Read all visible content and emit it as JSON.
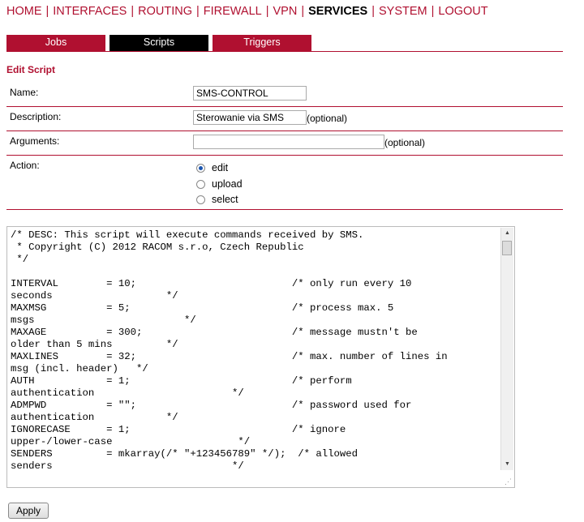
{
  "nav": {
    "items": [
      {
        "label": "HOME",
        "active": false
      },
      {
        "label": "INTERFACES",
        "active": false
      },
      {
        "label": "ROUTING",
        "active": false
      },
      {
        "label": "FIREWALL",
        "active": false
      },
      {
        "label": "VPN",
        "active": false
      },
      {
        "label": "SERVICES",
        "active": true
      },
      {
        "label": "SYSTEM",
        "active": false
      },
      {
        "label": "LOGOUT",
        "active": false
      }
    ],
    "separator": "|"
  },
  "tabs": [
    {
      "label": "Jobs",
      "active": false
    },
    {
      "label": "Scripts",
      "active": true
    },
    {
      "label": "Triggers",
      "active": false
    }
  ],
  "section_title": "Edit Script",
  "form": {
    "name_label": "Name:",
    "name_value": "SMS-CONTROL",
    "description_label": "Description:",
    "description_value": "Sterowanie via SMS",
    "description_hint": "(optional)",
    "arguments_label": "Arguments:",
    "arguments_value": "",
    "arguments_hint": "(optional)",
    "action_label": "Action:",
    "action_options": [
      {
        "label": "edit",
        "checked": true
      },
      {
        "label": "upload",
        "checked": false
      },
      {
        "label": "select",
        "checked": false
      }
    ]
  },
  "script_text": "/* DESC: This script will execute commands received by SMS.\n * Copyright (C) 2012 RACOM s.r.o, Czech Republic\n */\n\nINTERVAL        = 10;                          /* only run every 10\nseconds                   */\nMAXMSG          = 5;                           /* process max. 5\nmsgs                         */\nMAXAGE          = 300;                         /* message mustn't be\nolder than 5 mins         */\nMAXLINES        = 32;                          /* max. number of lines in\nmsg (incl. header)   */\nAUTH            = 1;                           /* perform\nauthentication                       */\nADMPWD          = \"\";                          /* password used for\nauthentication            */\nIGNORECASE      = 1;                           /* ignore\nupper-/lower-case                     */\nSENDERS         = mkarray(/* \"+123456789\" */);  /* allowed\nsenders                              */",
  "apply_label": "Apply",
  "colors": {
    "accent": "#b01030",
    "active_tab": "#000000",
    "radio_dot": "#1a55b0"
  }
}
